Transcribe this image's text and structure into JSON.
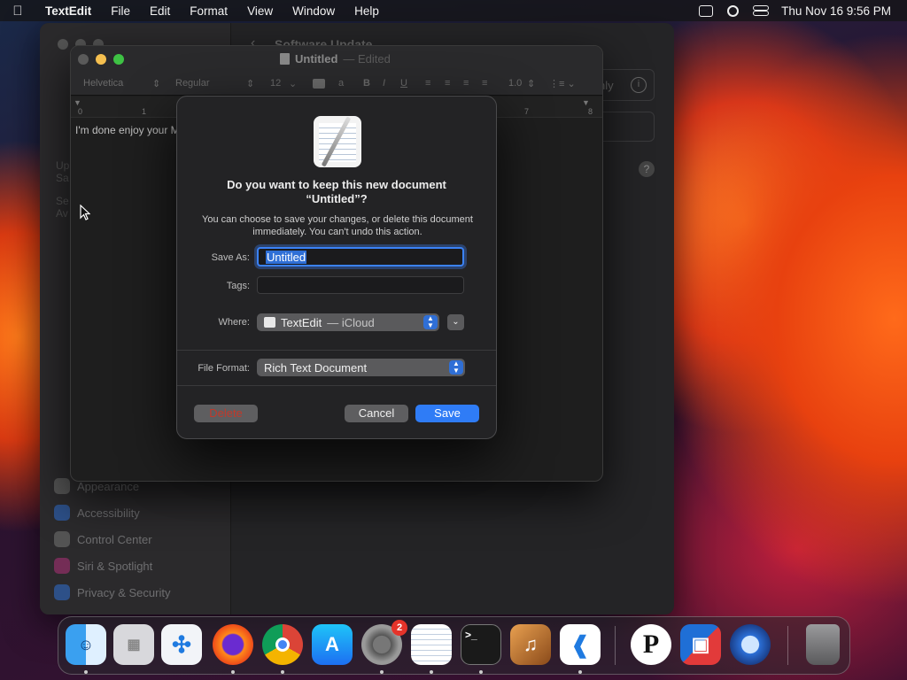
{
  "menubar": {
    "app_name": "TextEdit",
    "items": [
      "File",
      "Edit",
      "Format",
      "View",
      "Window",
      "Help"
    ],
    "datetime": "Thu Nov 16  9:56 PM"
  },
  "settings_window": {
    "title": "Software Update",
    "only_button": "nly",
    "sidebar_items": [
      "Appearance",
      "Accessibility",
      "Control Center",
      "Siri & Spotlight",
      "Privacy & Security"
    ],
    "ghost_left": [
      "Up",
      "Sa",
      "Se",
      "Av"
    ]
  },
  "textedit": {
    "title": "Untitled",
    "title_status": "— Edited",
    "font_family": "Helvetica",
    "font_style": "Regular",
    "font_size": "12",
    "line_spacing": "1.0",
    "ruler_marks": [
      "0",
      "1",
      "7",
      "8"
    ],
    "body_text": "I'm done enjoy your M"
  },
  "dialog": {
    "title_line1": "Do you want to keep this new document",
    "title_line2": "“Untitled”?",
    "message": "You can choose to save your changes, or delete this document immediately. You can't undo this action.",
    "save_as_label": "Save As:",
    "save_as_value": "Untitled",
    "tags_label": "Tags:",
    "where_label": "Where:",
    "where_app": "TextEdit",
    "where_location": "— iCloud",
    "file_format_label": "File Format:",
    "file_format_value": "Rich Text Document",
    "delete_button": "Delete",
    "cancel_button": "Cancel",
    "save_button": "Save"
  },
  "dock": {
    "apps": [
      "Finder",
      "Launchpad",
      "Safari",
      "Firefox",
      "Chrome",
      "App Store",
      "System Settings",
      "TextEdit",
      "Terminal",
      "GarageBand",
      "VS Code",
      "P",
      "Remote Desktop",
      "QuickTime",
      "Trash"
    ],
    "settings_badge": "2"
  },
  "colors": {
    "accent": "#2f7cf6",
    "delete_text": "#c0392b",
    "badge": "#e5332a"
  }
}
